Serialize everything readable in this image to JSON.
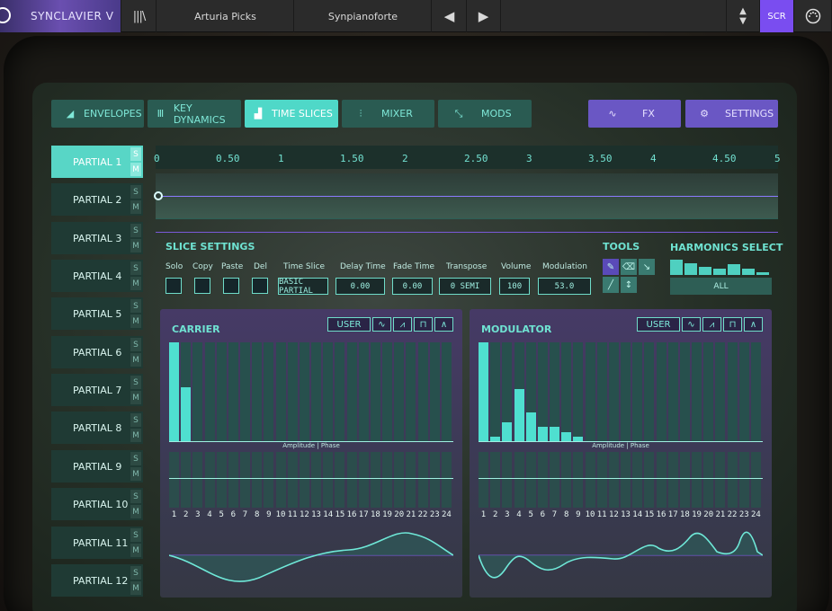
{
  "topbar": {
    "brand": "SYNCLAVIER V",
    "library_icon": "library-icon",
    "picks": "Arturia Picks",
    "preset": "Synpianoforte",
    "prev": "◀",
    "next": "▶",
    "scr": "SCR"
  },
  "tabs": [
    {
      "label": "ENVELOPES",
      "icon": "envelope-icon"
    },
    {
      "label": "KEY DYNAMICS",
      "icon": "key-dynamics-icon"
    },
    {
      "label": "TIME SLICES",
      "icon": "time-slices-icon"
    },
    {
      "label": "MIXER",
      "icon": "mixer-icon"
    },
    {
      "label": "MODS",
      "icon": "mods-icon"
    },
    {
      "label": "FX",
      "icon": "fx-wave-icon"
    },
    {
      "label": "SETTINGS",
      "icon": "gear-icon"
    }
  ],
  "partials": [
    "PARTIAL 1",
    "PARTIAL 2",
    "PARTIAL 3",
    "PARTIAL 4",
    "PARTIAL 5",
    "PARTIAL 6",
    "PARTIAL 7",
    "PARTIAL 8",
    "PARTIAL 9",
    "PARTIAL 10",
    "PARTIAL 11",
    "PARTIAL 12"
  ],
  "solo_mute": {
    "s": "S",
    "m": "M"
  },
  "ruler": [
    "0",
    "0.50",
    "1",
    "1.50",
    "2",
    "2.50",
    "3",
    "3.50",
    "4",
    "4.50",
    "5"
  ],
  "slice": {
    "title": "SLICE SETTINGS",
    "labels": {
      "solo": "Solo",
      "copy": "Copy",
      "paste": "Paste",
      "del": "Del",
      "time_slice": "Time Slice",
      "delay": "Delay Time",
      "fade": "Fade Time",
      "transpose": "Transpose",
      "volume": "Volume",
      "modulation": "Modulation"
    },
    "values": {
      "time_slice": "BASIC PARTIAL",
      "delay": "0.00",
      "fade": "0.00",
      "transpose": "0 SEMI",
      "volume": "100",
      "modulation": "53.0"
    }
  },
  "tools": {
    "title": "TOOLS"
  },
  "harmonics": {
    "title": "HARMONICS SELECT",
    "all": "ALL",
    "levels": [
      1.0,
      0.75,
      0.55,
      0.4,
      0.7,
      0.4,
      0.2
    ]
  },
  "carrier": {
    "title": "CARRIER",
    "user": "USER",
    "amp_label": "Amplitude | Phase",
    "amps": [
      1.0,
      0.55,
      0,
      0,
      0,
      0,
      0,
      0,
      0,
      0,
      0,
      0,
      0,
      0,
      0,
      0,
      0,
      0,
      0,
      0,
      0,
      0,
      0,
      0
    ]
  },
  "modulator": {
    "title": "MODULATOR",
    "user": "USER",
    "amp_label": "Amplitude | Phase",
    "amps": [
      1.0,
      0.05,
      0.2,
      0.53,
      0.3,
      0.15,
      0.15,
      0.1,
      0.05,
      0,
      0,
      0,
      0,
      0,
      0,
      0,
      0,
      0,
      0,
      0,
      0,
      0,
      0,
      0
    ]
  },
  "harmonic_numbers": [
    "1",
    "2",
    "3",
    "4",
    "5",
    "6",
    "7",
    "8",
    "9",
    "10",
    "11",
    "12",
    "13",
    "14",
    "15",
    "16",
    "17",
    "18",
    "19",
    "20",
    "21",
    "22",
    "23",
    "24"
  ],
  "colors": {
    "accent": "#4fd8c8",
    "purple": "#6a57c4",
    "scr": "#7a4df0"
  }
}
